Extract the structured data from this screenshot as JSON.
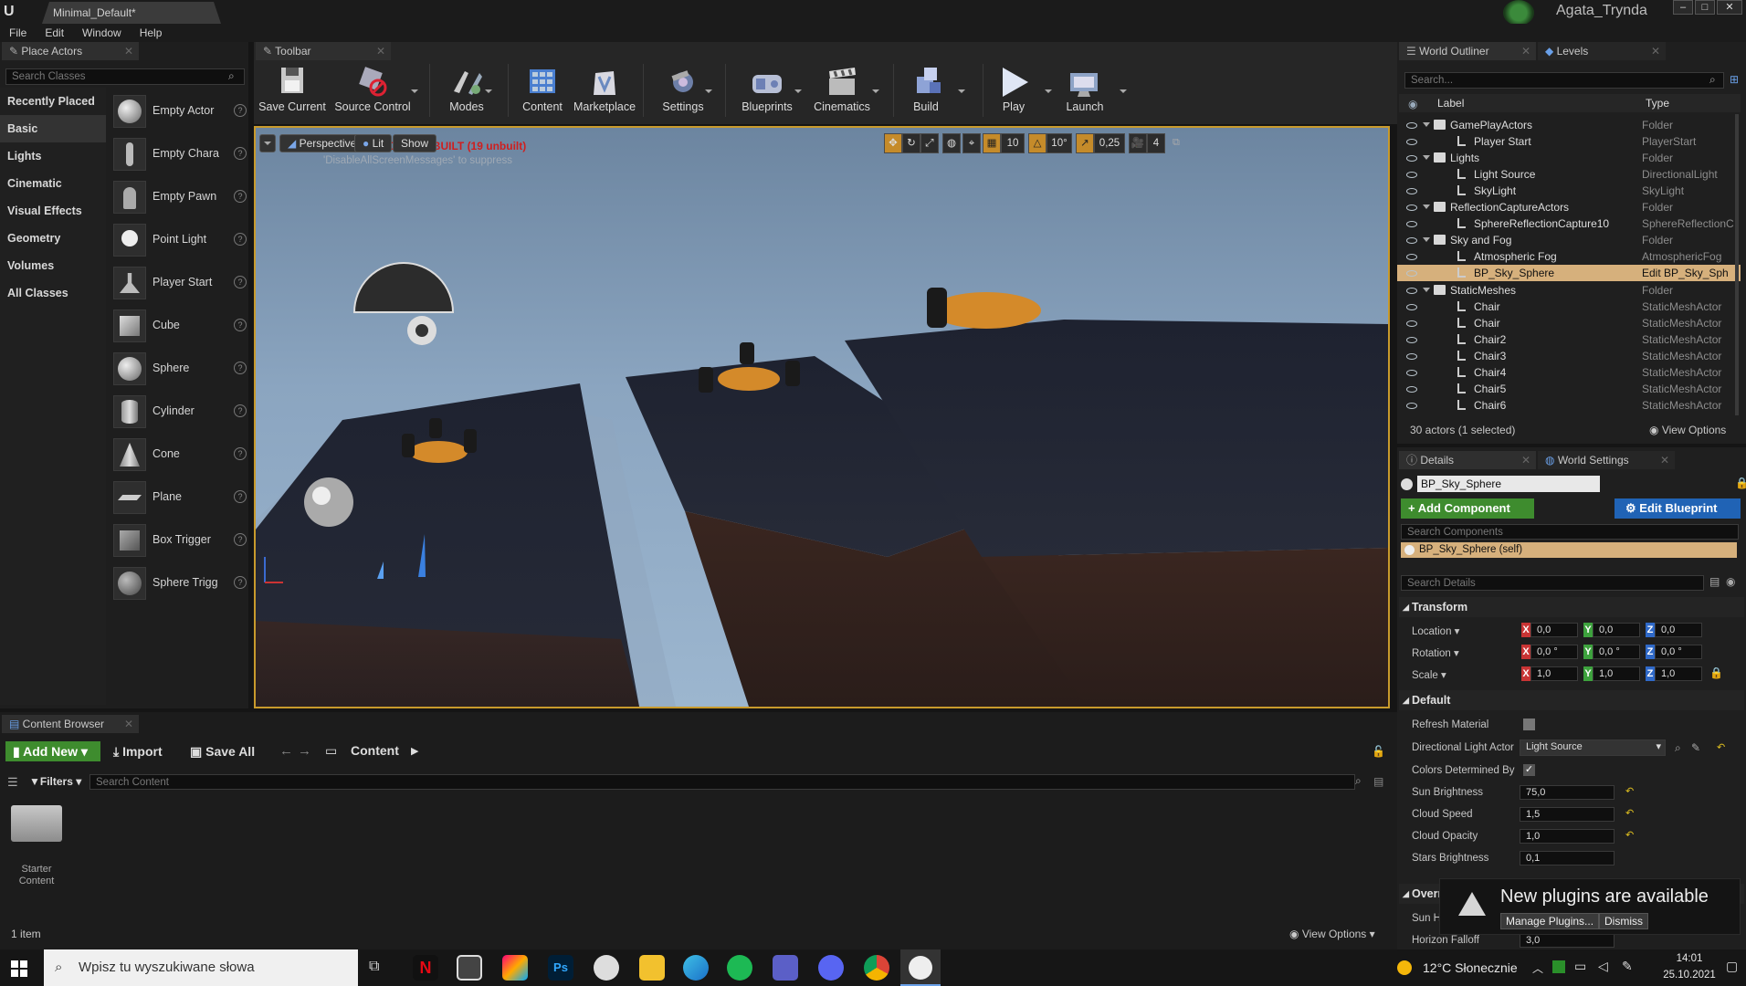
{
  "window": {
    "tab_title": "Minimal_Default*",
    "user": "Agata_Trynda"
  },
  "menu": [
    "File",
    "Edit",
    "Window",
    "Help"
  ],
  "place_actors": {
    "tab": "Place Actors",
    "search_placeholder": "Search Classes",
    "categories": [
      "Recently Placed",
      "Basic",
      "Lights",
      "Cinematic",
      "Visual Effects",
      "Geometry",
      "Volumes",
      "All Classes"
    ],
    "selected_category": "Basic",
    "items": [
      "Empty Actor",
      "Empty Chara",
      "Empty Pawn",
      "Point Light",
      "Player Start",
      "Cube",
      "Sphere",
      "Cylinder",
      "Cone",
      "Plane",
      "Box Trigger",
      "Sphere Trigg"
    ]
  },
  "toolbar": {
    "tab": "Toolbar",
    "buttons": [
      "Save Current",
      "Source Control",
      "Modes",
      "Content",
      "Marketplace",
      "Settings",
      "Blueprints",
      "Cinematics",
      "Build",
      "Play",
      "Launch"
    ]
  },
  "viewport": {
    "perspective": "Perspective",
    "lit": "Lit",
    "show": "Show",
    "warning": "LIGHTING NEEDS TO BE REBUILT (19 unbuilt)",
    "suppress": "'DisableAllScreenMessages' to suppress",
    "grid_snap": "10",
    "rot_snap": "10°",
    "scale_snap": "0,25",
    "cam_speed": "4"
  },
  "outliner": {
    "tab": "World Outliner",
    "levels_tab": "Levels",
    "search_placeholder": "Search...",
    "col_label": "Label",
    "col_type": "Type",
    "rows": [
      {
        "label": "GamePlayActors",
        "type": "Folder",
        "kind": "folder",
        "indent": 1
      },
      {
        "label": "Player Start",
        "type": "PlayerStart",
        "kind": "actor",
        "indent": 2
      },
      {
        "label": "Lights",
        "type": "Folder",
        "kind": "folder",
        "indent": 1
      },
      {
        "label": "Light Source",
        "type": "DirectionalLight",
        "kind": "actor",
        "indent": 2
      },
      {
        "label": "SkyLight",
        "type": "SkyLight",
        "kind": "actor",
        "indent": 2
      },
      {
        "label": "ReflectionCaptureActors",
        "type": "Folder",
        "kind": "folder",
        "indent": 1
      },
      {
        "label": "SphereReflectionCapture10",
        "type": "SphereReflectionC",
        "kind": "actor",
        "indent": 2
      },
      {
        "label": "Sky and Fog",
        "type": "Folder",
        "kind": "folder",
        "indent": 1
      },
      {
        "label": "Atmospheric Fog",
        "type": "AtmosphericFog",
        "kind": "actor",
        "indent": 2
      },
      {
        "label": "BP_Sky_Sphere",
        "type": "Edit BP_Sky_Sph",
        "kind": "actor",
        "indent": 2,
        "selected": true
      },
      {
        "label": "StaticMeshes",
        "type": "Folder",
        "kind": "folder",
        "indent": 1
      },
      {
        "label": "Chair",
        "type": "StaticMeshActor",
        "kind": "actor",
        "indent": 2
      },
      {
        "label": "Chair",
        "type": "StaticMeshActor",
        "kind": "actor",
        "indent": 2
      },
      {
        "label": "Chair2",
        "type": "StaticMeshActor",
        "kind": "actor",
        "indent": 2
      },
      {
        "label": "Chair3",
        "type": "StaticMeshActor",
        "kind": "actor",
        "indent": 2
      },
      {
        "label": "Chair4",
        "type": "StaticMeshActor",
        "kind": "actor",
        "indent": 2
      },
      {
        "label": "Chair5",
        "type": "StaticMeshActor",
        "kind": "actor",
        "indent": 2
      },
      {
        "label": "Chair6",
        "type": "StaticMeshActor",
        "kind": "actor",
        "indent": 2
      }
    ],
    "status": "30 actors (1 selected)",
    "view_options": "View Options"
  },
  "details": {
    "tab": "Details",
    "world_settings_tab": "World Settings",
    "name": "BP_Sky_Sphere",
    "add_component": "+ Add Component",
    "edit_blueprint": "Edit Blueprint",
    "search_components": "Search Components",
    "component_self": "BP_Sky_Sphere (self)",
    "search_details": "Search Details",
    "transform_header": "Transform",
    "location_label": "Location",
    "rotation_label": "Rotation",
    "scale_label": "Scale",
    "location": [
      "0,0",
      "0,0",
      "0,0"
    ],
    "rotation": [
      "0,0 °",
      "0,0 °",
      "0,0 °"
    ],
    "scale": [
      "1,0",
      "1,0",
      "1,0"
    ],
    "default_header": "Default",
    "refresh_material": "Refresh Material",
    "directional_light_actor": "Directional Light Actor",
    "directional_light_value": "Light Source",
    "colors_determined": "Colors Determined By",
    "sun_brightness": "Sun Brightness",
    "sun_brightness_value": "75,0",
    "cloud_speed": "Cloud Speed",
    "cloud_speed_value": "1,5",
    "cloud_opacity": "Cloud Opacity",
    "cloud_opacity_value": "1,0",
    "stars_brightness": "Stars Brightness",
    "stars_brightness_value": "0,1",
    "override_header": "Overr",
    "sun_h": "Sun H",
    "horizon_falloff": "Horizon Falloff",
    "horizon_falloff_value": "3,0"
  },
  "notification": {
    "title": "New plugins are available",
    "manage": "Manage Plugins...",
    "dismiss": "Dismiss"
  },
  "content_browser": {
    "tab": "Content Browser",
    "add_new": "Add New",
    "import": "Import",
    "save_all": "Save All",
    "path": "Content",
    "filters": "Filters",
    "search_placeholder": "Search Content",
    "folder_name": "Starter Content",
    "item_count": "1 item",
    "view_options": "View Options"
  },
  "taskbar": {
    "search_placeholder": "Wpisz tu wyszukiwane słowa",
    "weather": "12°C Słonecznie",
    "time": "14:01",
    "date": "25.10.2021"
  }
}
